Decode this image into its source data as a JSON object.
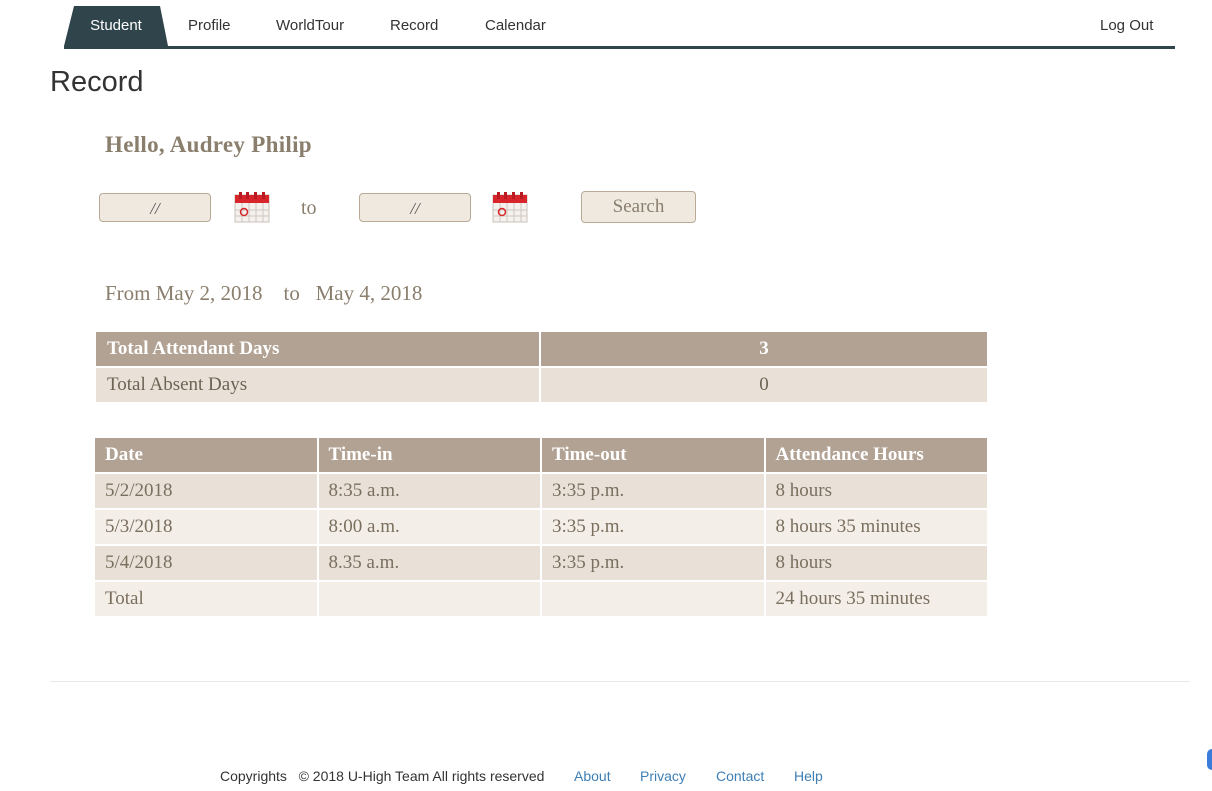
{
  "nav": {
    "active": "Student",
    "items": [
      "Profile",
      "WorldTour",
      "Record",
      "Calendar"
    ],
    "logout": "Log Out",
    "accent_color": "#2f444b"
  },
  "page": {
    "title": "Record"
  },
  "greeting": "Hello, Audrey Philip",
  "filter": {
    "from_value": "//",
    "to_label": "to",
    "to_value": "//",
    "search_label": "Search"
  },
  "range": {
    "from_text": "From May 2, 2018",
    "to_text": "to",
    "end_text": "May 4, 2018"
  },
  "summary": {
    "attendant_label": "Total Attendant Days",
    "attendant_value": "3",
    "absent_label": "Total Absent Days",
    "absent_value": "0"
  },
  "attendance": {
    "columns": [
      "Date",
      "Time-in",
      "Time-out",
      "Attendance Hours"
    ],
    "rows": [
      [
        "5/2/2018",
        "8:35 a.m.",
        "3:35 p.m.",
        "8 hours"
      ],
      [
        "5/3/2018",
        "8:00 a.m.",
        "3:35 p.m.",
        "8 hours 35 minutes"
      ],
      [
        "5/4/2018",
        "8.35 a.m.",
        "3:35 p.m.",
        "8 hours"
      ],
      [
        "Total",
        "",
        "",
        "24 hours 35 minutes"
      ]
    ]
  },
  "footer": {
    "copyright": "Copyrights   © 2018 U-High Team All rights reserved",
    "links": [
      "About",
      "Privacy",
      "Contact",
      "Help"
    ]
  },
  "colors": {
    "table_header": "#b2a293",
    "table_row": "#e9e1d8",
    "table_row_alt": "#f3efe8",
    "text_brown": "#8a7e6d",
    "link": "#3d7fb5"
  }
}
